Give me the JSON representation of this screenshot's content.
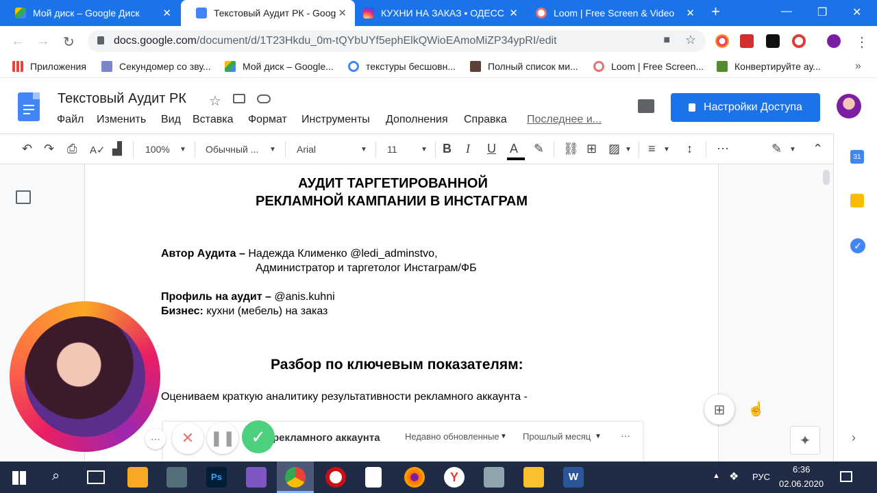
{
  "tabs": [
    {
      "title": "Мой диск – Google Диск",
      "active": false
    },
    {
      "title": "Текстовый Аудит РК - Goog",
      "active": true
    },
    {
      "title": "КУХНИ НА ЗАКАЗ • ОДЕССА",
      "active": false
    },
    {
      "title": "Loom | Free Screen & Video",
      "active": false
    }
  ],
  "browser": {
    "url_host": "docs.google.com",
    "url_path": "/document/d/1T23Hkdu_0m-tQYbUYf5ephElkQWioEAmoMiZP34ypRI/edit",
    "extension_badge": "7"
  },
  "bookmarks": [
    {
      "label": "Приложения"
    },
    {
      "label": "Секундомер со зву..."
    },
    {
      "label": "Мой диск – Google..."
    },
    {
      "label": "текстуры бесшовн..."
    },
    {
      "label": "Полный список ми..."
    },
    {
      "label": "Loom | Free Screen..."
    },
    {
      "label": "Конвертируйте ау..."
    }
  ],
  "docs": {
    "title": "Текстовый Аудит РК",
    "menu": [
      "Файл",
      "Изменить",
      "Вид",
      "Вставка",
      "Формат",
      "Инструменты",
      "Дополнения",
      "Справка"
    ],
    "last_edit": "Последнее и...",
    "share_label": "Настройки Доступа"
  },
  "format_toolbar": {
    "zoom": "100%",
    "style": "Обычный ...",
    "font": "Arial",
    "size": "11"
  },
  "document": {
    "heading_line1": "АУДИТ ТАРГЕТИРОВАННОЙ",
    "heading_line2": "РЕКЛАМНОЙ КАМПАНИИ В ИНСТАГРАМ",
    "author_label": "Автор Аудита –",
    "author_value": " Надежда Клименко @ledi_adminstvo,",
    "author_value2": "Администратор и таргетолог Инстаграм/ФБ",
    "profile_label": "Профиль на аудит –",
    "profile_value": " @anis.kuhni",
    "business_label": "Бизнес:",
    "business_value": " кухни (мебель) на заказ",
    "section_heading": "Разбор по ключевым показателям:",
    "intro": "Оцениваем краткую аналитику результативности рекламного аккаунта -"
  },
  "embed": {
    "title": "рекламного аккаунта",
    "sort": "Недавно обновленные",
    "period": "Прошлый месяц",
    "more": "···"
  },
  "taskbar": {
    "lang": "РУС",
    "time": "6:36",
    "date": "02.06.2020"
  },
  "colors": {
    "chrome_blue": "#1a73e8",
    "docs_blue": "#4285f4",
    "taskbar": "#1f2a44"
  }
}
